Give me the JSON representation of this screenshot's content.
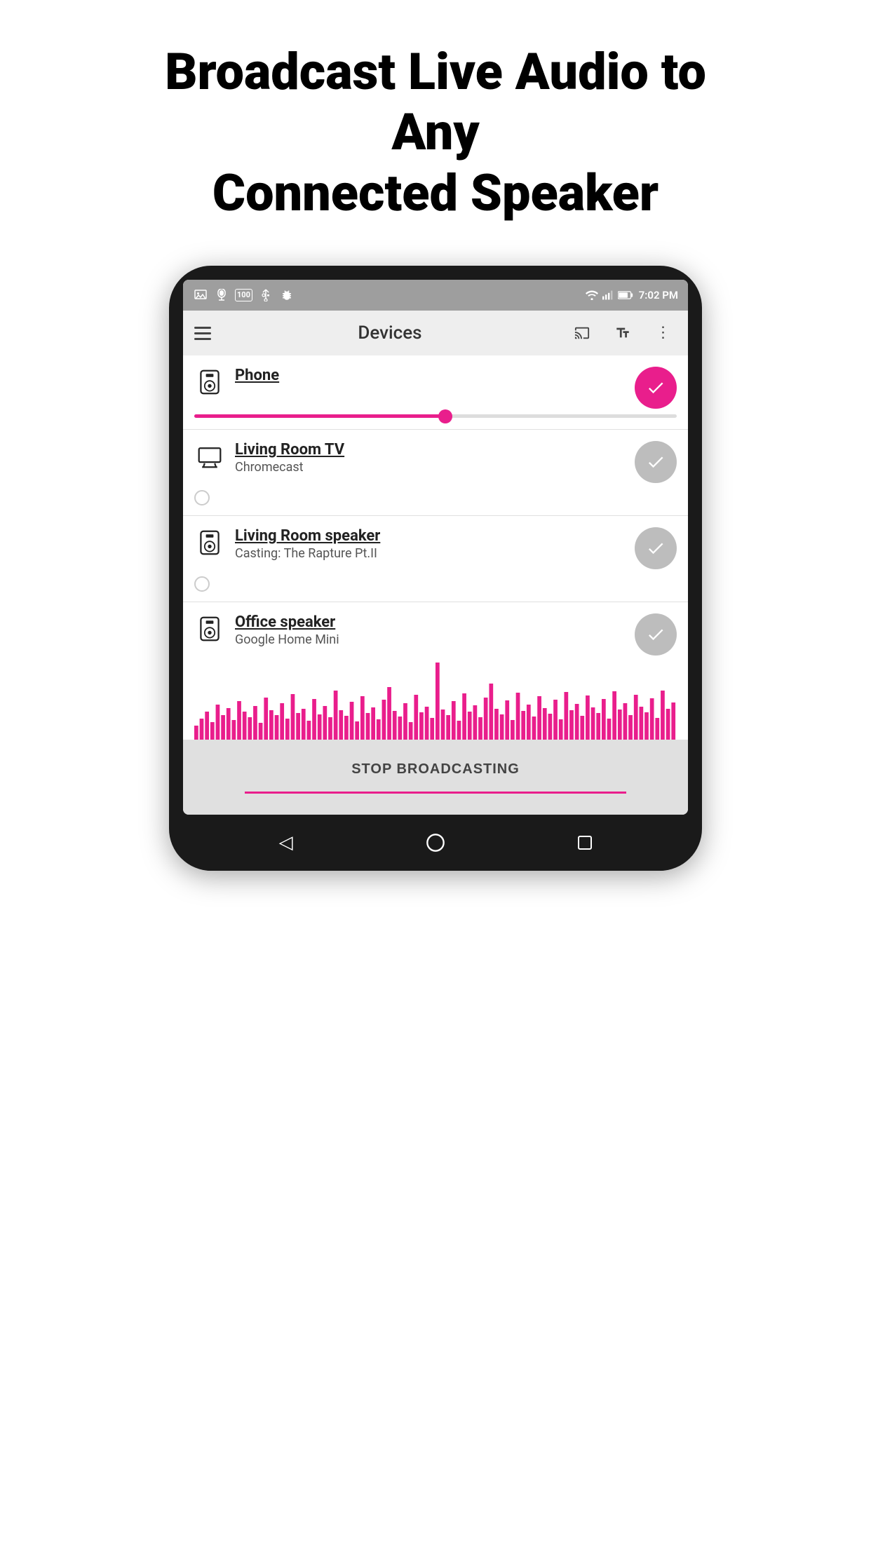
{
  "headline": {
    "line1": "Broadcast Live Audio to Any",
    "line2": "Connected Speaker"
  },
  "appBar": {
    "title": "Devices",
    "menuIcon": "☰",
    "castLabel": "cast-icon",
    "textLabel": "A",
    "moreLabel": "⋮"
  },
  "statusBar": {
    "time": "7:02 PM",
    "icons": [
      "image",
      "speaker",
      "100",
      "usb",
      "bug",
      "wifi",
      "signal",
      "battery"
    ]
  },
  "devices": [
    {
      "name": "Phone",
      "sub": "",
      "type": "speaker",
      "active": true,
      "hasSlider": true,
      "sliderValue": 52
    },
    {
      "name": "Living Room TV",
      "sub": "Chromecast",
      "type": "tv",
      "active": false,
      "hasSlider": false
    },
    {
      "name": "Living Room speaker",
      "sub": "Casting: The Rapture Pt.II",
      "type": "speaker",
      "active": false,
      "hasSlider": false
    },
    {
      "name": "Office speaker",
      "sub": "Google Home Mini",
      "type": "speaker",
      "active": false,
      "hasSlider": false,
      "hasWaveform": true
    }
  ],
  "stopButton": {
    "label": "STOP BROADCASTING"
  },
  "navBar": {
    "back": "◁",
    "home": "○",
    "recents": "□"
  },
  "colors": {
    "accent": "#e91e8c",
    "inactiveCheck": "#bdbdbd",
    "appBarBg": "#eeeeee",
    "statusBarBg": "#9e9e9e",
    "stopBg": "#e0e0e0"
  }
}
